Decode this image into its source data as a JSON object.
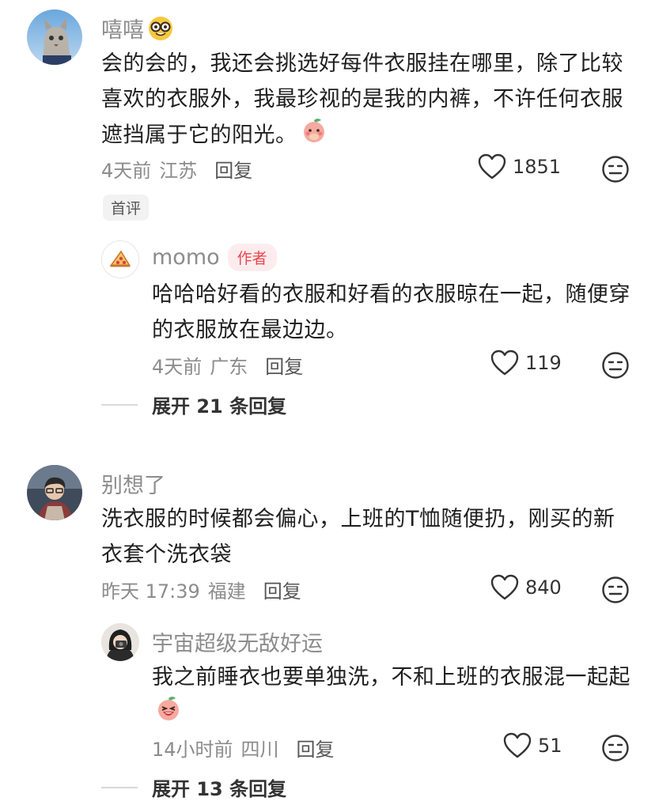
{
  "comments": [
    {
      "username": "嘻嘻",
      "text": "会的会的，我还会挑选好每件衣服挂在哪里，除了比较喜欢的衣服外，我最珍视的是我的内裤，不许任何衣服遮挡属于它的阳光。",
      "time": "4天前",
      "location": "江苏",
      "reply_label": "回复",
      "likes": "1851",
      "badge": "首评",
      "replies": [
        {
          "username": "momo",
          "author_badge": "作者",
          "text": "哈哈哈好看的衣服和好看的衣服晾在一起，随便穿的衣服放在最边边。",
          "time": "4天前",
          "location": "广东",
          "reply_label": "回复",
          "likes": "119"
        }
      ],
      "expand_label": "展开 21 条回复"
    },
    {
      "username": "别想了",
      "text": "洗衣服的时候都会偏心，上班的T恤随便扔，刚买的新衣套个洗衣袋",
      "time": "昨天 17:39",
      "location": "福建",
      "reply_label": "回复",
      "likes": "840",
      "replies": [
        {
          "username": "宇宙超级无敌好运",
          "text": "我之前睡衣也要单独洗，不和上班的衣服混一起起",
          "time": "14小时前",
          "location": "四川",
          "reply_label": "回复",
          "likes": "51"
        }
      ],
      "expand_label": "展开 13 条回复"
    }
  ],
  "icons": {
    "heart": "heart-outline-icon",
    "dislike": "neutral-face-icon",
    "nerd_emoji": "nerd-face-emoji",
    "peach_shy_emoji": "peach-shy-emoji",
    "peach_laugh_emoji": "peach-laugh-emoji",
    "pizza_avatar": "pizza-avatar-icon"
  },
  "colors": {
    "author_badge_bg": "#fdecee",
    "author_badge_text": "#e8464f",
    "secondary_text": "#8c8c8c"
  }
}
